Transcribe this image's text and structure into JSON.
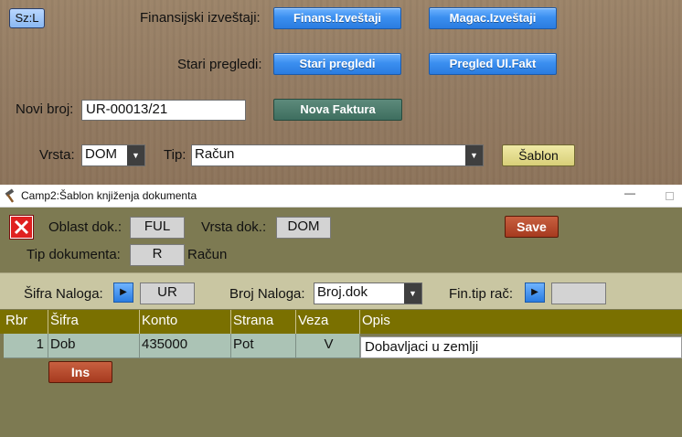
{
  "header": {
    "sz_button": "Sz:L",
    "fin_label": "Finansijski izveštaji:",
    "fin_button": "Finans.Izveštaji",
    "magac_button": "Magac.Izveštaji",
    "stari_label": "Stari pregledi:",
    "stari_button": "Stari pregledi",
    "pregled_button": "Pregled Ul.Fakt",
    "novi_label": "Novi broj:",
    "novi_value": "UR-00013/21",
    "nova_button": "Nova Faktura",
    "vrsta_label": "Vrsta:",
    "vrsta_value": "DOM",
    "tip_label": "Tip:",
    "tip_value": "Račun",
    "sablon_button": "Šablon"
  },
  "dialog": {
    "title": "Camp2:Šablon knjiženja dokumenta",
    "minimize": "—",
    "oblast_label": "Oblast dok.:",
    "oblast_value": "FUL",
    "vrsta_label": "Vrsta dok.:",
    "vrsta_value": "DOM",
    "save_button": "Save",
    "tip_label": "Tip dokumenta:",
    "tip_value": "R",
    "tip_name": "Račun",
    "sifra_naloga_label": "Šifra Naloga:",
    "sifra_naloga_value": "UR",
    "broj_naloga_label": "Broj Naloga:",
    "broj_naloga_value": "Broj.dok",
    "fin_tip_label": "Fin.tip rač:",
    "fin_tip_value": "",
    "ins_button": "Ins"
  },
  "grid": {
    "columns": [
      "Rbr",
      "Šifra",
      "Konto",
      "Strana",
      "Veza",
      "Opis"
    ],
    "rows": [
      {
        "rbr": "1",
        "sifra": "Dob",
        "konto": "435000",
        "strana": "Pot",
        "veza": "V",
        "opis": "Dobavljaci u zemlji"
      }
    ]
  },
  "colors": {
    "wood": "#937b62",
    "button_blue": "#3b8ff0",
    "button_green": "#3e6e5f",
    "button_red": "#a63a1f",
    "dialog_olive": "#7d7a52",
    "grid_header": "#7a7000",
    "grid_row": "#abc3b5"
  },
  "icons": [
    "hammer-icon",
    "close-x-icon",
    "play-arrow-icon",
    "dropdown-arrow-icon"
  ]
}
